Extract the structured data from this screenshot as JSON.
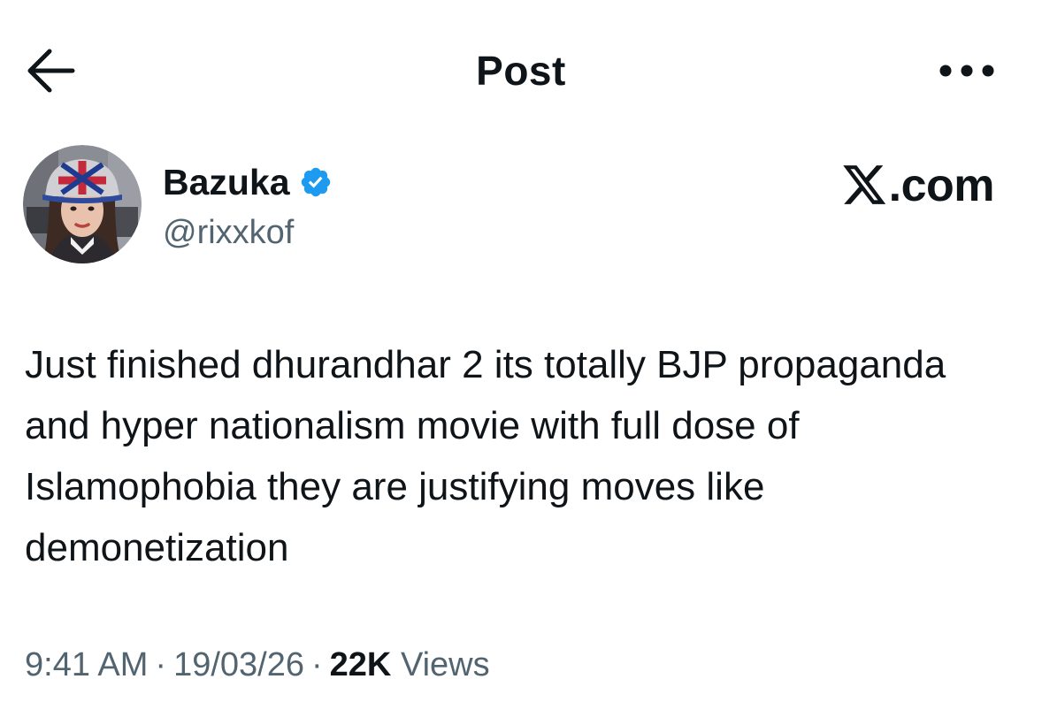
{
  "header": {
    "title": "Post",
    "back_icon": "arrow-left-icon",
    "more_icon": "more-horizontal-icon"
  },
  "author": {
    "display_name": "Bazuka",
    "handle": "@rixxkof",
    "verified_icon": "verified-badge-icon",
    "verified_color": "#1d9bf0"
  },
  "watermark": {
    "logo_icon": "x-logo-icon",
    "text": ".com"
  },
  "post": {
    "text": "Just finished dhurandhar 2 its totally BJP propaganda and hyper nationalism movie with full dose of Islamophobia they are justifying moves like demonetization"
  },
  "meta": {
    "time": "9:41 AM",
    "date": "19/03/26",
    "views_count": "22K",
    "views_label": "Views",
    "separator": "·"
  },
  "colors": {
    "text_primary": "#0f1419",
    "text_secondary": "#536471",
    "accent": "#1d9bf0",
    "background": "#ffffff"
  }
}
